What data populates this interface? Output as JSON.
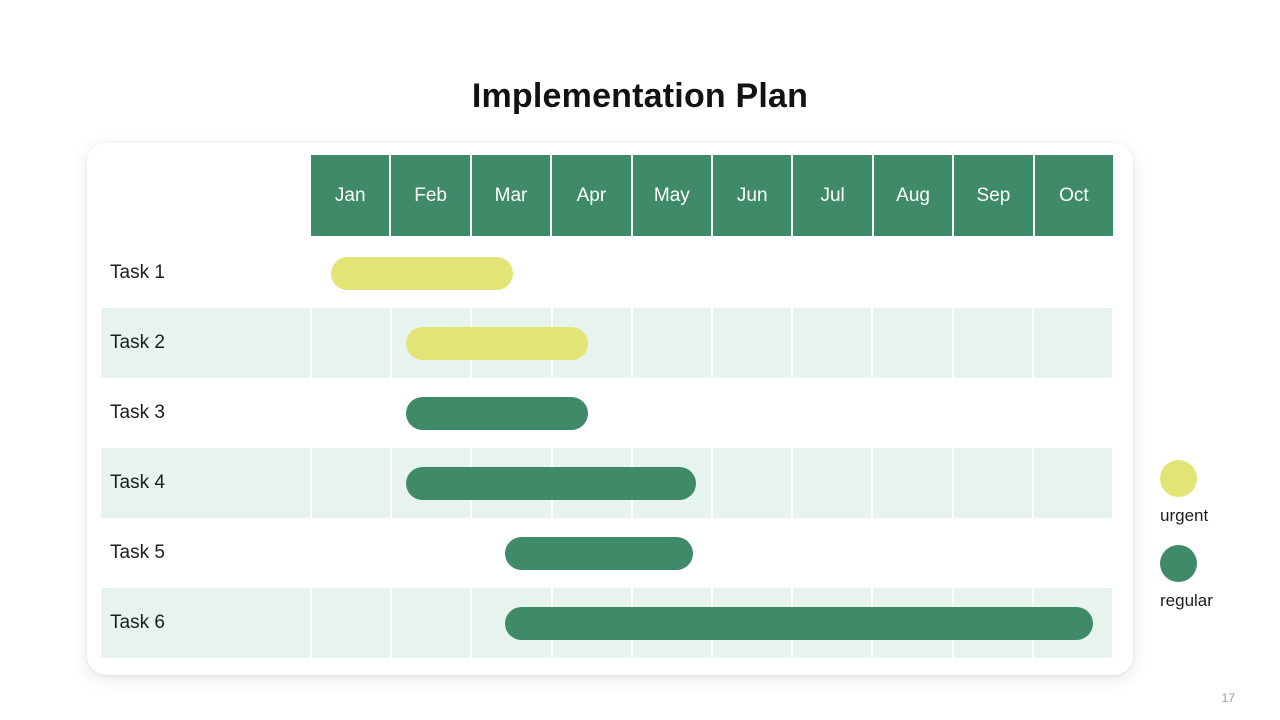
{
  "slide": {
    "title": "Implementation Plan",
    "page_number": "17",
    "colors": {
      "urgent": "#e3e476",
      "regular": "#3f8b69",
      "row_alt_background": "#e7f4ee",
      "card_background": "#ffffff",
      "title_text": "#121212"
    }
  },
  "chart_data": {
    "type": "bar",
    "title": "Implementation Plan",
    "xlabel": "",
    "ylabel": "",
    "orientation": "horizontal",
    "subtype": "gantt",
    "grid": true,
    "legend_position": "right",
    "categories": [
      "Task 1",
      "Task 2",
      "Task 3",
      "Task 4",
      "Task 5",
      "Task 6"
    ],
    "x_tick_labels": [
      "Jan",
      "Feb",
      "Mar",
      "Apr",
      "May",
      "Jun",
      "Jul",
      "Aug",
      "Sep",
      "Oct"
    ],
    "xlim": [
      "Jan",
      "Oct"
    ],
    "legend": [
      {
        "name": "urgent",
        "color": "#e3e476"
      },
      {
        "name": "regular",
        "color": "#3f8b69"
      }
    ],
    "tasks": [
      {
        "label": "Task 1",
        "category": "urgent",
        "start_month": "Jan",
        "end_month": "Mar",
        "start_index": 0.25,
        "end_index": 2.52
      },
      {
        "label": "Task 2",
        "category": "urgent",
        "start_month": "Feb",
        "end_month": "Apr",
        "start_index": 1.18,
        "end_index": 3.45
      },
      {
        "label": "Task 3",
        "category": "regular",
        "start_month": "Feb",
        "end_month": "Apr",
        "start_index": 1.18,
        "end_index": 3.45
      },
      {
        "label": "Task 4",
        "category": "regular",
        "start_month": "Feb",
        "end_month": "May",
        "start_index": 1.18,
        "end_index": 4.8
      },
      {
        "label": "Task 5",
        "category": "regular",
        "start_month": "Mar",
        "end_month": "May",
        "start_index": 2.42,
        "end_index": 4.76
      },
      {
        "label": "Task 6",
        "category": "regular",
        "start_month": "Mar",
        "end_month": "Oct",
        "start_index": 2.42,
        "end_index": 9.75
      }
    ]
  }
}
